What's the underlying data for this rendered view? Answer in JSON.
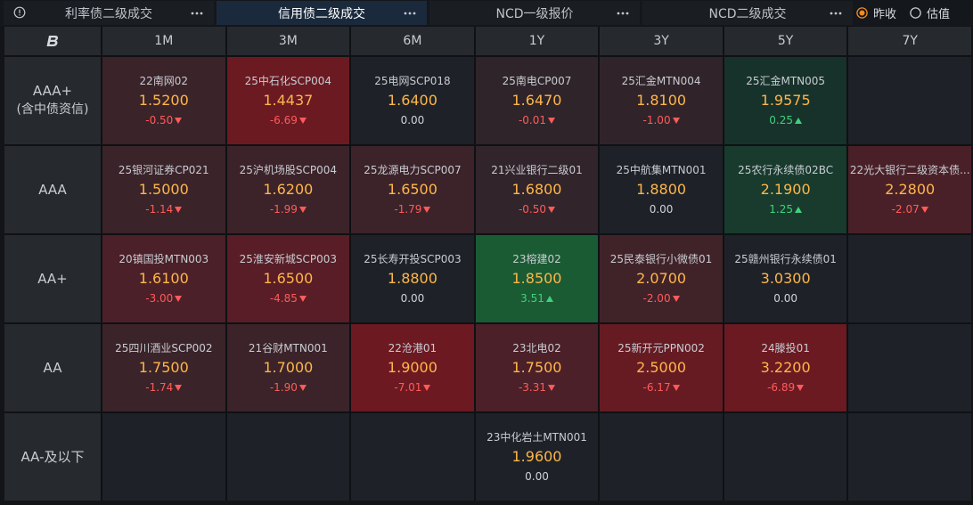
{
  "tabs": [
    {
      "label": "利率债二级成交",
      "active": false
    },
    {
      "label": "信用债二级成交",
      "active": true
    },
    {
      "label": "NCD一级报价",
      "active": false
    },
    {
      "label": "NCD二级成交",
      "active": false
    }
  ],
  "icons": {
    "info": "info-icon",
    "more": "more-icon",
    "logo": "brand-logo-icon"
  },
  "price_basis": [
    {
      "label": "昨收",
      "selected": true
    },
    {
      "label": "估值",
      "selected": false
    }
  ],
  "colors": {
    "accent": "#f08a24",
    "price": "#ffb64a",
    "down": "#ff5b5b",
    "up": "#3fd27e",
    "flat": "#d0d3d8",
    "empty_cell": "#1e2228",
    "active_tab": "#1a2a3c"
  },
  "grid": {
    "columns": [
      "1M",
      "3M",
      "6M",
      "1Y",
      "3Y",
      "5Y",
      "7Y"
    ],
    "rows": [
      {
        "rating": "AAA+",
        "note": "(含中债资信)",
        "cells": [
          {
            "name": "22南网02",
            "price": "1.5200",
            "change": "-0.50",
            "arrow_icon": "down-arrow-icon",
            "bg": "#3a2329"
          },
          {
            "name": "25中石化SCP004",
            "price": "1.4437",
            "change": "-6.69",
            "arrow_icon": "down-arrow-icon",
            "bg": "#6b1a22"
          },
          {
            "name": "25电网SCP018",
            "price": "1.6400",
            "change": "0.00",
            "bg": "#1e2228"
          },
          {
            "name": "25南电CP007",
            "price": "1.6470",
            "change": "-0.01",
            "arrow_icon": "down-arrow-icon",
            "bg": "#2e2429"
          },
          {
            "name": "25汇金MTN004",
            "price": "1.8100",
            "change": "-1.00",
            "arrow_icon": "down-arrow-icon",
            "bg": "#30242a"
          },
          {
            "name": "25汇金MTN005",
            "price": "1.9575",
            "change": "0.25",
            "arrow_icon": "up-arrow-icon",
            "bg": "#17322a"
          },
          null
        ]
      },
      {
        "rating": "AAA",
        "cells": [
          {
            "name": "25银河证券CP021",
            "price": "1.5000",
            "change": "-1.14",
            "arrow_icon": "down-arrow-icon",
            "bg": "#3a2329"
          },
          {
            "name": "25沪机场股SCP004",
            "price": "1.6200",
            "change": "-1.99",
            "arrow_icon": "down-arrow-icon",
            "bg": "#3c2329"
          },
          {
            "name": "25龙源电力SCP007",
            "price": "1.6500",
            "change": "-1.79",
            "arrow_icon": "down-arrow-icon",
            "bg": "#3b2329"
          },
          {
            "name": "21兴业银行二级01",
            "price": "1.6800",
            "change": "-0.50",
            "arrow_icon": "down-arrow-icon",
            "bg": "#31242a"
          },
          {
            "name": "25中航集MTN001",
            "price": "1.8800",
            "change": "0.00",
            "bg": "#1e2228"
          },
          {
            "name": "25农行永续债02BC",
            "price": "2.1900",
            "change": "1.25",
            "arrow_icon": "up-arrow-icon",
            "bg": "#183b2d"
          },
          {
            "name": "22光大银行二级资本债...",
            "price": "2.2800",
            "change": "-2.07",
            "arrow_icon": "down-arrow-icon",
            "bg": "#4a2028"
          }
        ]
      },
      {
        "rating": "AA+",
        "cells": [
          {
            "name": "20镇国投MTN003",
            "price": "1.6100",
            "change": "-3.00",
            "arrow_icon": "down-arrow-icon",
            "bg": "#4b2028"
          },
          {
            "name": "25淮安新城SCP003",
            "price": "1.6500",
            "change": "-4.85",
            "arrow_icon": "down-arrow-icon",
            "bg": "#581d26"
          },
          {
            "name": "25长寿开投SCP003",
            "price": "1.8800",
            "change": "0.00",
            "bg": "#1e2228"
          },
          {
            "name": "23榕建02",
            "price": "1.8500",
            "change": "3.51",
            "arrow_icon": "up-arrow-icon",
            "bg": "#1b5b34"
          },
          {
            "name": "25民泰银行小微债01",
            "price": "2.0700",
            "change": "-2.00",
            "arrow_icon": "down-arrow-icon",
            "bg": "#402329"
          },
          {
            "name": "25赣州银行永续债01",
            "price": "3.0300",
            "change": "0.00",
            "bg": "#1e2228"
          },
          null
        ]
      },
      {
        "rating": "AA",
        "cells": [
          {
            "name": "25四川酒业SCP002",
            "price": "1.7500",
            "change": "-1.74",
            "arrow_icon": "down-arrow-icon",
            "bg": "#3a2329"
          },
          {
            "name": "21谷财MTN001",
            "price": "1.7000",
            "change": "-1.90",
            "arrow_icon": "down-arrow-icon",
            "bg": "#3b2329"
          },
          {
            "name": "22沧港01",
            "price": "1.9000",
            "change": "-7.01",
            "arrow_icon": "down-arrow-icon",
            "bg": "#6d1921"
          },
          {
            "name": "23北电02",
            "price": "1.7500",
            "change": "-3.31",
            "arrow_icon": "down-arrow-icon",
            "bg": "#4b2028"
          },
          {
            "name": "25新开元PPN002",
            "price": "2.5000",
            "change": "-6.17",
            "arrow_icon": "down-arrow-icon",
            "bg": "#661b23"
          },
          {
            "name": "24滕投01",
            "price": "3.2200",
            "change": "-6.89",
            "arrow_icon": "down-arrow-icon",
            "bg": "#6b1a22"
          },
          null
        ]
      },
      {
        "rating": "AA-及以下",
        "cells": [
          null,
          null,
          null,
          {
            "name": "23中化岩土MTN001",
            "price": "1.9600",
            "change": "0.00",
            "bg": "#1e2228"
          },
          null,
          null,
          null
        ]
      }
    ]
  }
}
